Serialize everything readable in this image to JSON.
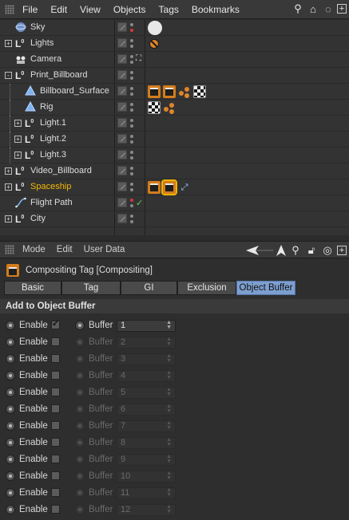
{
  "om_menu": [
    "File",
    "Edit",
    "View",
    "Objects",
    "Tags",
    "Bookmarks"
  ],
  "om_icons": [
    "search-icon",
    "home-icon",
    "eye-icon",
    "new-window-icon"
  ],
  "objects": [
    {
      "name": "Sky",
      "level": 0,
      "icon": "sky",
      "dots": [
        "grey",
        "red"
      ],
      "tags": [
        "sky"
      ]
    },
    {
      "name": "Lights",
      "level": 0,
      "icon": "null",
      "expander": "+",
      "dots": [
        "grey",
        "grey"
      ],
      "tags": [
        "ban"
      ]
    },
    {
      "name": "Camera",
      "level": 0,
      "icon": "camera",
      "dots": [
        "grey",
        "grey"
      ],
      "status": "target",
      "tags": []
    },
    {
      "name": "Print_Billboard",
      "level": 0,
      "icon": "null",
      "expander": "-",
      "dots": [
        "grey",
        "grey"
      ],
      "tags": []
    },
    {
      "name": "Billboard_Surface",
      "level": 1,
      "icon": "poly",
      "dots": [
        "grey",
        "grey"
      ],
      "tags": [
        "clap",
        "clap",
        "balls",
        "checker"
      ]
    },
    {
      "name": "Rig",
      "level": 1,
      "icon": "poly",
      "dots": [
        "grey",
        "grey"
      ],
      "tags": [
        "checker",
        "balls"
      ]
    },
    {
      "name": "Light.1",
      "level": 1,
      "icon": "null",
      "expander": "+",
      "dots": [
        "grey",
        "grey"
      ],
      "tags": []
    },
    {
      "name": "Light.2",
      "level": 1,
      "icon": "null",
      "expander": "+",
      "dots": [
        "grey",
        "grey"
      ],
      "tags": []
    },
    {
      "name": "Light.3",
      "level": 1,
      "icon": "null",
      "expander": "+",
      "dots": [
        "grey",
        "grey"
      ],
      "tags": []
    },
    {
      "name": "Video_Billboard",
      "level": 0,
      "icon": "null",
      "expander": "+",
      "dots": [
        "grey",
        "grey"
      ],
      "tags": []
    },
    {
      "name": "Spaceship",
      "level": 0,
      "icon": "null",
      "expander": "+",
      "selected": true,
      "dots": [
        "grey",
        "grey"
      ],
      "tags": [
        "clap",
        "clap-active",
        "align"
      ]
    },
    {
      "name": "Flight Path",
      "level": 0,
      "icon": "spline",
      "dots": [
        "red",
        "grey"
      ],
      "status": "check",
      "tags": []
    },
    {
      "name": "City",
      "level": 0,
      "icon": "null",
      "expander": "+",
      "dots": [
        "grey",
        "grey"
      ],
      "tags": []
    }
  ],
  "am_menu": [
    "Mode",
    "Edit",
    "User Data"
  ],
  "am_icons": [
    "back-arrow-icon",
    "cursor-arrow-icon",
    "search-icon",
    "lock-icon",
    "target-icon",
    "new-window-icon"
  ],
  "am_title": "Compositing Tag [Compositing]",
  "tabs": [
    {
      "label": "Basic",
      "active": false
    },
    {
      "label": "Tag",
      "active": false
    },
    {
      "label": "GI",
      "active": false
    },
    {
      "label": "Exclusion",
      "active": false
    },
    {
      "label": "Object Buffer",
      "active": true
    }
  ],
  "section_title": "Add to Object Buffer",
  "enable_label": "Enable",
  "buffer_label": "Buffer",
  "buffers": [
    {
      "enabled": true,
      "value": "1"
    },
    {
      "enabled": false,
      "value": "2"
    },
    {
      "enabled": false,
      "value": "3"
    },
    {
      "enabled": false,
      "value": "4"
    },
    {
      "enabled": false,
      "value": "5"
    },
    {
      "enabled": false,
      "value": "6"
    },
    {
      "enabled": false,
      "value": "7"
    },
    {
      "enabled": false,
      "value": "8"
    },
    {
      "enabled": false,
      "value": "9"
    },
    {
      "enabled": false,
      "value": "10"
    },
    {
      "enabled": false,
      "value": "11"
    },
    {
      "enabled": false,
      "value": "12"
    }
  ],
  "colors": {
    "selected_text": "#f5b800",
    "active_tab": "#7d9fcf",
    "tag_orange": "#d37c1c"
  }
}
